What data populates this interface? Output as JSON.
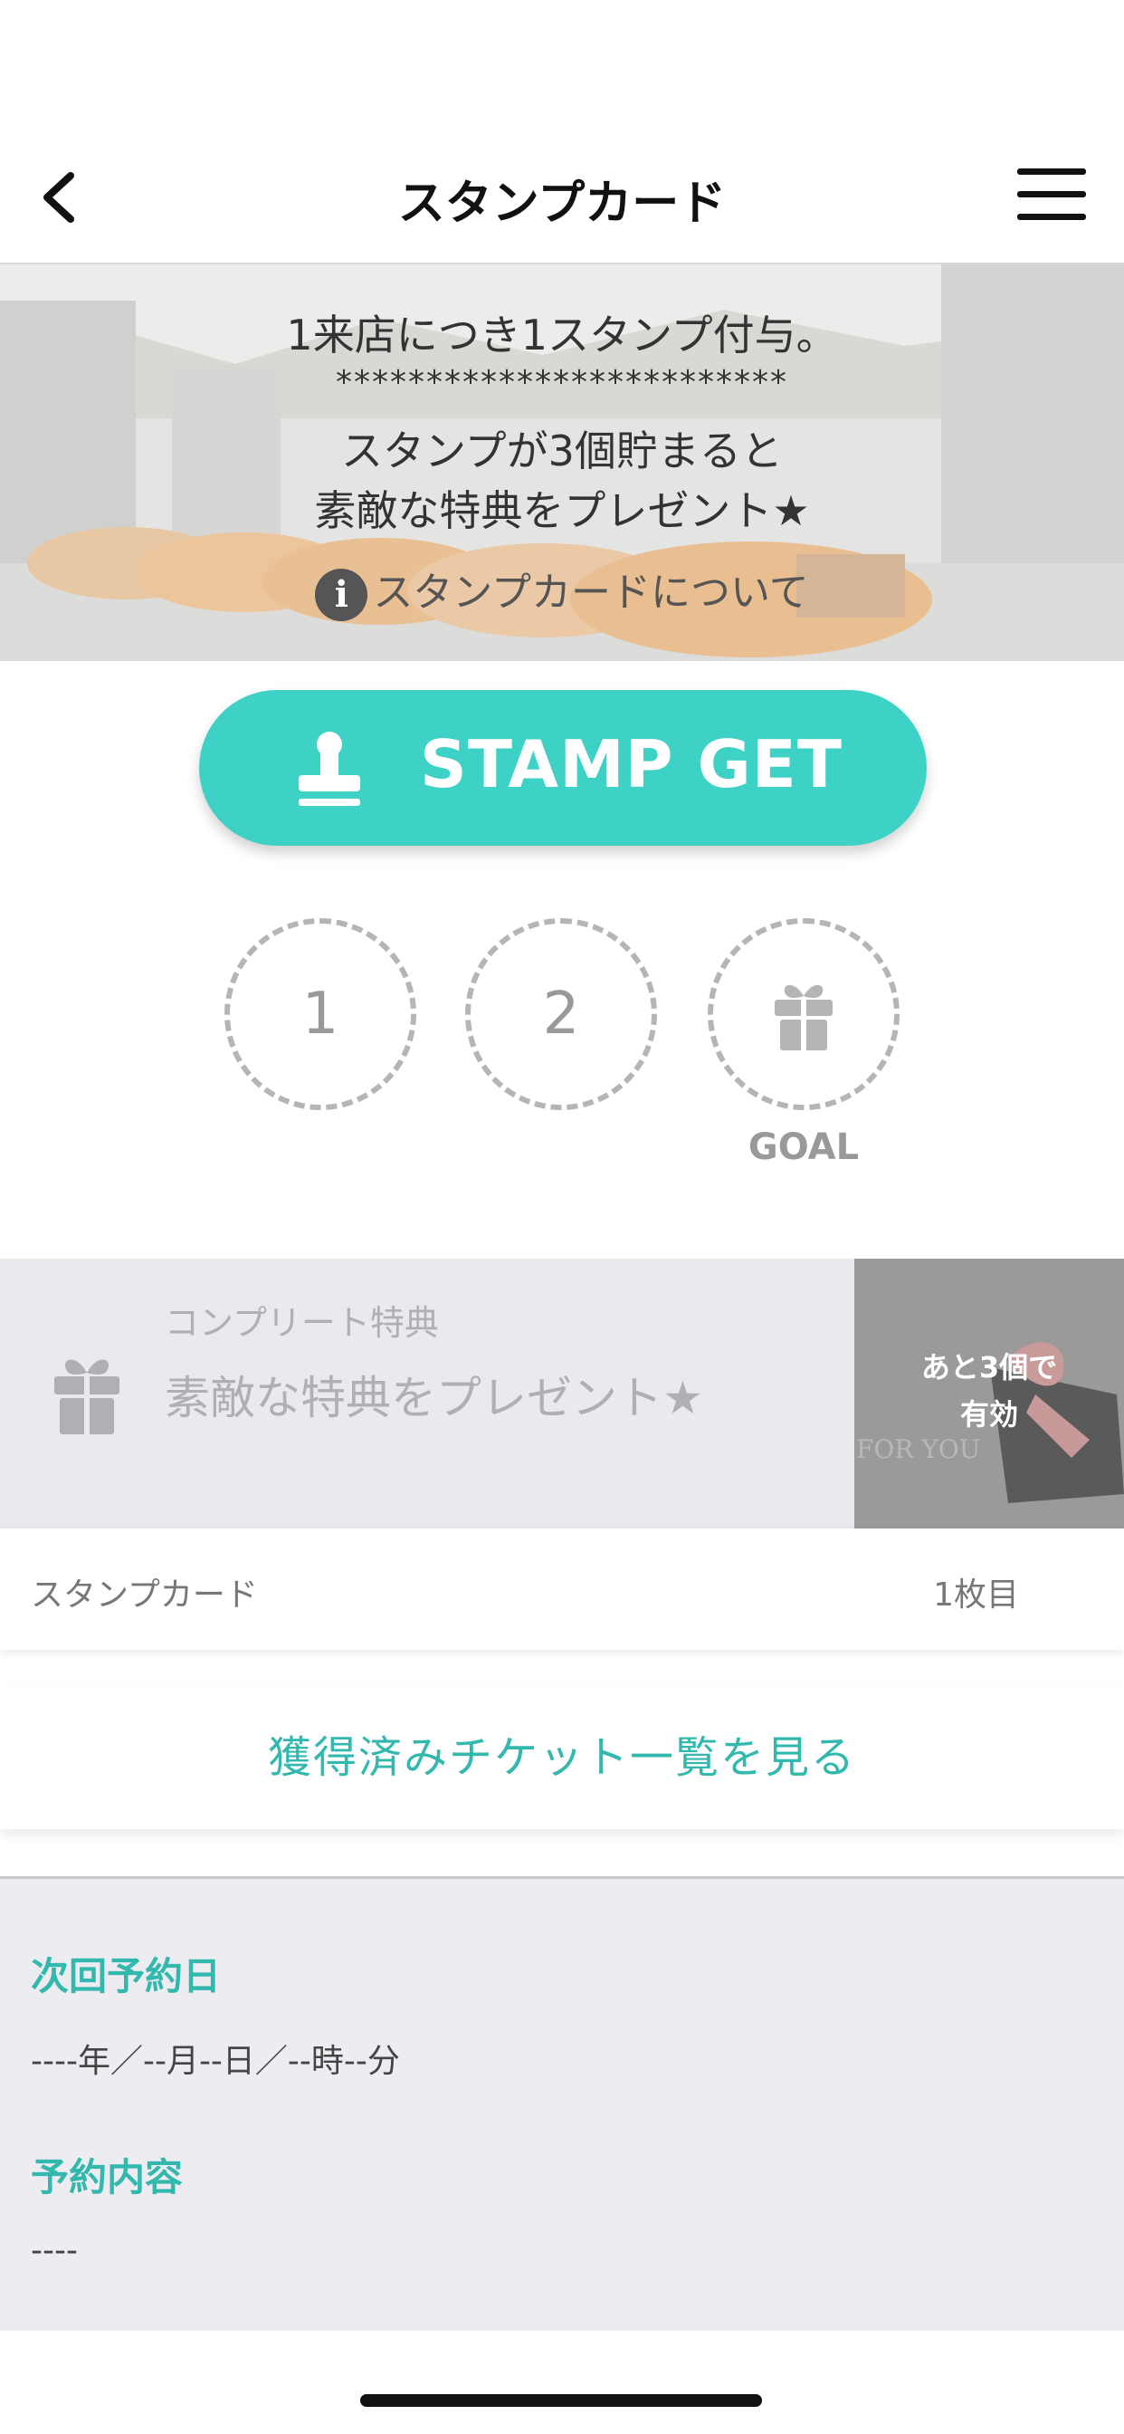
{
  "header": {
    "title": "スタンプカード",
    "back_icon": "chevron-left-icon",
    "menu_icon": "hamburger-menu-icon"
  },
  "banner": {
    "line1": "1来店につき1スタンプ付与。",
    "line2": "*************************",
    "line3": "スタンプが3個貯まると",
    "line4": "素敵な特典をプレゼント★",
    "info_icon_glyph": "i",
    "info_link": "スタンプカードについて"
  },
  "stamp_button": {
    "label": "STAMP GET",
    "color": "#3ed1c6"
  },
  "slots": {
    "items": [
      "1",
      "2"
    ],
    "goal_label": "GOAL"
  },
  "benefit": {
    "caption": "コンプリート特典",
    "title": "素敵な特典をプレゼント★",
    "badge_line1": "あと3個で",
    "badge_line2": "有効",
    "image_text": "FOR YOU"
  },
  "card": {
    "label": "スタンプカード",
    "value": "1枚目"
  },
  "tickets_link": "獲得済みチケット一覧を見る",
  "reservation": {
    "next_date_title": "次回予約日",
    "next_date_value": "----年／--月--日／--時--分",
    "content_title": "予約内容",
    "content_value": "----"
  },
  "colors": {
    "accent": "#33b8ae",
    "button": "#3ed1c6"
  }
}
